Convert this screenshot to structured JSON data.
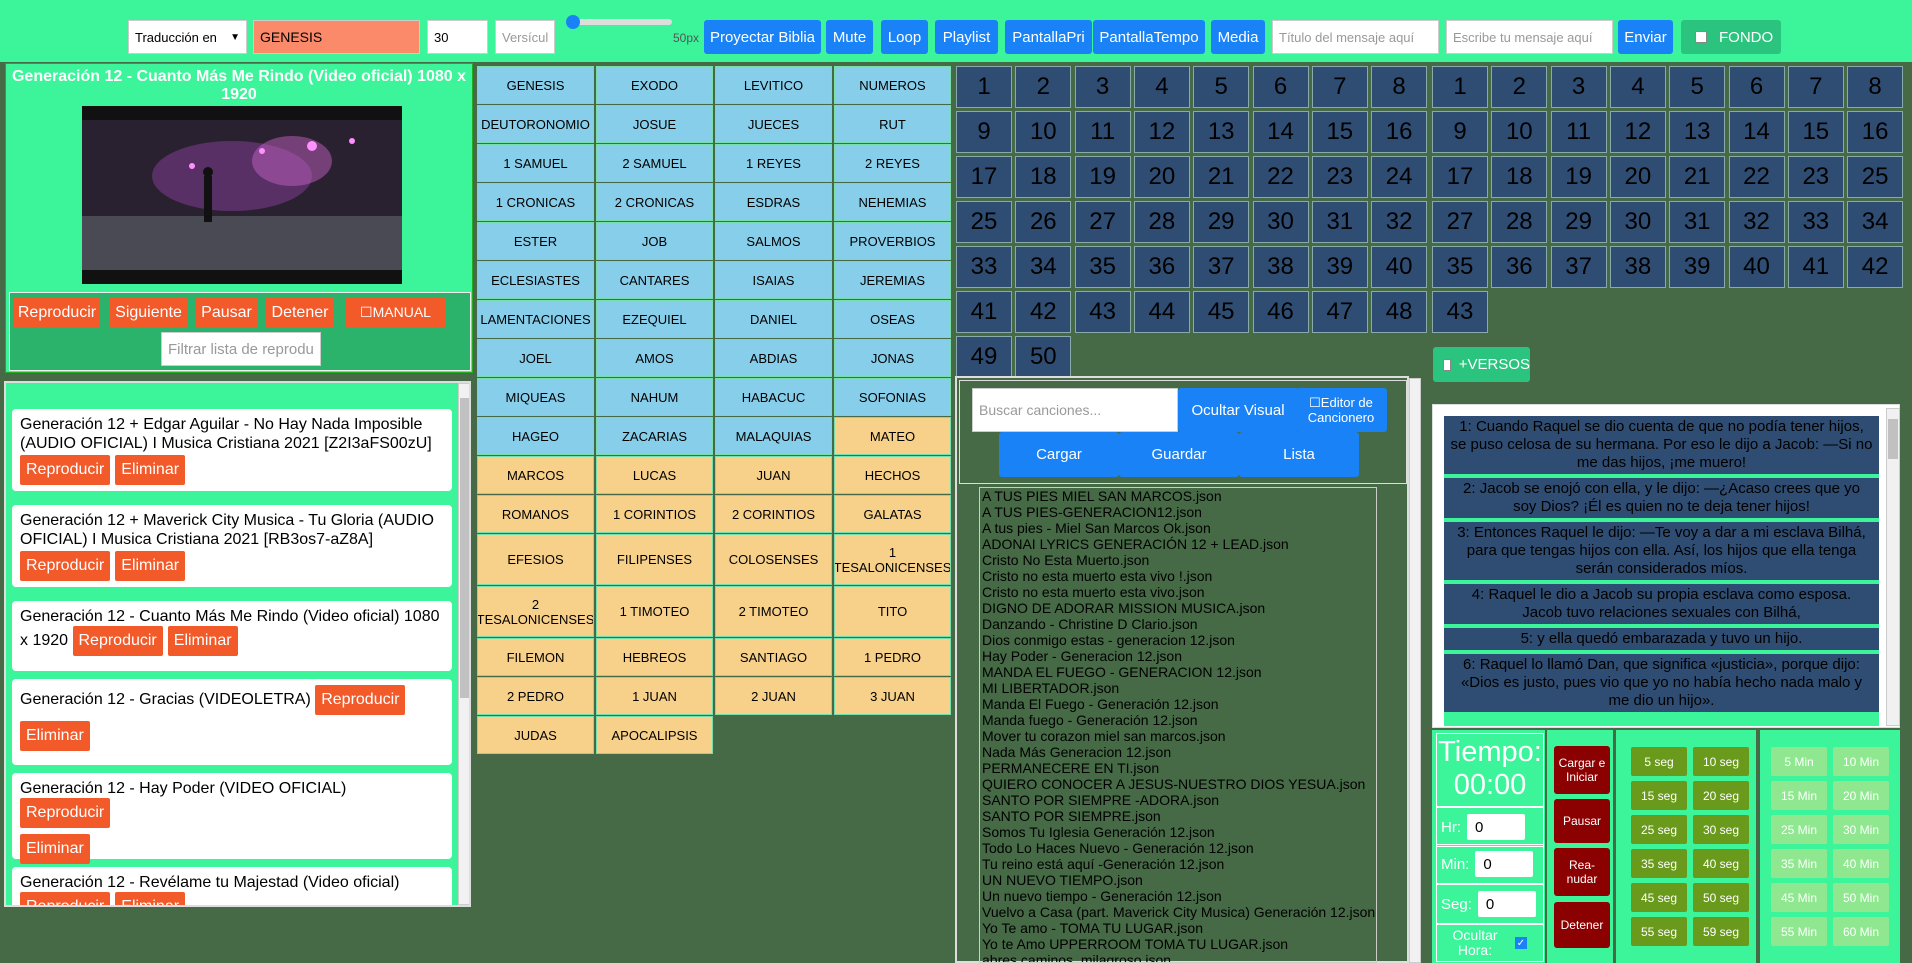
{
  "topbar": {
    "translation": "Traducción en",
    "book": "GENESIS",
    "font_size": "30",
    "verse_placeholder": "Versículo",
    "slider_label": "50px",
    "buttons": [
      "Proyectar Biblia",
      "Mute",
      "Loop",
      "Playlist",
      "PantallaPri",
      "PantallaTempo",
      "Media"
    ],
    "title_placeholder": "Título del mensaje aquí",
    "message_placeholder": "Escribe tu mensaje aquí",
    "send_label": "Enviar",
    "fondo_label": "FONDO"
  },
  "video": {
    "title": "Generación 12 - Cuanto Más Me Rindo (Video oficial) 1080 x 1920",
    "controls": [
      "Reproducir",
      "Siguiente",
      "Pausar",
      "Detener"
    ],
    "manual_label": "☐MANUAL",
    "filter_placeholder": "Filtrar lista de reproducción"
  },
  "playlist": {
    "play_label": "Reproducir",
    "delete_label": "Eliminar",
    "items": [
      "Generación 12 + Edgar Aguilar - No Hay Nada Imposible (AUDIO OFICIAL) I Musica Cristiana 2021 [Z2I3aFS00zU]",
      "Generación 12 + Maverick City Musica - Tu Gloria (AUDIO OFICIAL) I Musica Cristiana 2021 [RB3os7-aZ8A]",
      "Generación 12 - Cuanto Más Me Rindo (Video oficial) 1080 x 1920",
      "Generación 12 - Gracias (VIDEOLETRA)",
      "Generación 12 - Hay Poder (VIDEO OFICIAL)",
      "Generación 12 - Revélame tu Majestad (Video oficial)"
    ]
  },
  "books": {
    "old": [
      "GENESIS",
      "EXODO",
      "LEVITICO",
      "NUMEROS",
      "DEUTORONOMIO",
      "JOSUE",
      "JUECES",
      "RUT",
      "1 SAMUEL",
      "2 SAMUEL",
      "1 REYES",
      "2 REYES",
      "1 CRONICAS",
      "2 CRONICAS",
      "ESDRAS",
      "NEHEMIAS",
      "ESTER",
      "JOB",
      "SALMOS",
      "PROVERBIOS",
      "ECLESIASTES",
      "CANTARES",
      "ISAIAS",
      "JEREMIAS",
      "LAMENTACIONES",
      "EZEQUIEL",
      "DANIEL",
      "OSEAS",
      "JOEL",
      "AMOS",
      "ABDIAS",
      "JONAS",
      "MIQUEAS",
      "NAHUM",
      "HABACUC",
      "SOFONIAS",
      "HAGEO",
      "ZACARIAS",
      "MALAQUIAS"
    ],
    "new": [
      "MATEO",
      "MARCOS",
      "LUCAS",
      "JUAN",
      "HECHOS",
      "ROMANOS",
      "1 CORINTIOS",
      "2 CORINTIOS",
      "GALATAS",
      "EFESIOS",
      "FILIPENSES",
      "COLOSENSES",
      "1 TESALONICENSES",
      "2 TESALONICENSES",
      "1 TIMOTEO",
      "2 TIMOTEO",
      "TITO",
      "FILEMON",
      "HEBREOS",
      "SANTIAGO",
      "1 PEDRO",
      "2 PEDRO",
      "1 JUAN",
      "2 JUAN",
      "3 JUAN",
      "JUDAS",
      "APOCALIPSIS"
    ]
  },
  "chapters_left": {
    "count": 50
  },
  "chapters_right": {
    "count": 43
  },
  "versos_label": "+VERSOS",
  "songs": {
    "search_placeholder": "Buscar canciones...",
    "hide_visual": "Ocultar Visual",
    "editor": "☐Editor de Cancionero",
    "load": "Cargar",
    "save": "Guardar",
    "list": "Lista",
    "files": [
      "A TUS PIES MIEL SAN MARCOS.json",
      "A TUS PIES-GENERACION12.json",
      "A tus pies - Miel San Marcos Ok.json",
      "ADONAI LYRICS GENERACIÓN 12 + LEAD.json",
      "Cristo No Esta Muerto.json",
      "Cristo no esta muerto esta vivo !.json",
      "Cristo no esta muerto esta vivo.json",
      "DIGNO DE ADORAR MISSION MUSICA.json",
      "Danzando - Christine D Clario.json",
      "Dios conmigo estas - generacion 12.json",
      "Hay Poder - Generacion 12.json",
      "MANDA EL FUEGO - GENERACION 12.json",
      "MI LIBERTADOR.json",
      "Manda El Fuego - Generación 12.json",
      "Manda fuego - Generación 12.json",
      "Mover tu corazon miel san marcos.json",
      "Nada Más Generacion 12.json",
      "PERMANECERE EN TI.json",
      "QUIERO CONOCER A JESUS-NUESTRO DIOS YESUA.json",
      "SANTO POR SIEMPRE -ADORA.json",
      "SANTO POR SIEMPRE.json",
      "Somos Tu Iglesia Generación 12.json",
      "Todo Lo Haces Nuevo - Generación 12.json",
      "Tu reino está aquí -Generación 12.json",
      "UN NUEVO TIEMPO.json",
      "Un nuevo tiempo - Generación 12.json",
      "Vuelvo a Casa (part. Maverick City Musica) Generación 12.json",
      "Yo Te amo - TOMA TU LUGAR.json",
      "Yo te Amo UPPERROOM TOMA TU LUGAR.json",
      "abres caminos_milagroso.json"
    ]
  },
  "verses": [
    "1: Cuando Raquel se dio cuenta de que no podía tener hijos, se puso celosa de su hermana. Por eso le dijo a Jacob: —Si no me das hijos, ¡me muero!",
    "2: Jacob se enojó con ella, y le dijo: —¿Acaso crees que yo soy Dios? ¡Él es quien no te deja tener hijos!",
    "3: Entonces Raquel le dijo: —Te voy a dar a mi esclava Bilhá, para que tengas hijos con ella. Así, los hijos que ella tenga serán considerados míos.",
    "4: Raquel le dio a Jacob su propia esclava como esposa. Jacob tuvo relaciones sexuales con Bilhá,",
    "5: y ella quedó embarazada y tuvo un hijo.",
    "6: Raquel lo llamó Dan, que significa «justicia», porque dijo: «Dios es justo, pues vio que yo no había hecho nada malo y me dio un hijo»."
  ],
  "timer": {
    "label": "Tiempo:",
    "value": "00:00",
    "hr_label": "Hr:",
    "hr": "0",
    "min_label": "Min:",
    "min": "0",
    "seg_label": "Seg:",
    "seg": "0",
    "hide_label": "Ocultar Hora:",
    "actions": [
      "Cargar e Iniciar",
      "Pausar",
      "Rea-nudar",
      "Detener"
    ],
    "seconds": [
      "5 seg",
      "10 seg",
      "15 seg",
      "20 seg",
      "25 seg",
      "30 seg",
      "35 seg",
      "40 seg",
      "45 seg",
      "50 seg",
      "55 seg",
      "59 seg"
    ],
    "minutes": [
      "5 Min",
      "10 Min",
      "15 Min",
      "20 Min",
      "25 Min",
      "30 Min",
      "35 Min",
      "40 Min",
      "45 Min",
      "50 Min",
      "55 Min",
      "60 Min"
    ]
  }
}
